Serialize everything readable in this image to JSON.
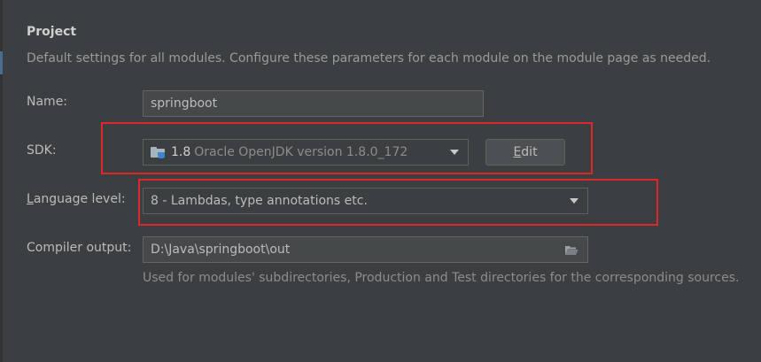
{
  "project": {
    "title": "Project",
    "description": "Default settings for all modules. Configure these parameters for each module on the module page as needed."
  },
  "name_row": {
    "label": "Name:",
    "value": "springboot"
  },
  "sdk_row": {
    "label": "SDK:",
    "sdk_version": "1.8",
    "sdk_detail": "Oracle OpenJDK version 1.8.0_172",
    "icon": "jdk-folder-icon",
    "edit_button": {
      "mnemonic": "E",
      "rest": "dit"
    }
  },
  "language_row": {
    "label_mnemonic": "L",
    "label_rest": "anguage level:",
    "selected": "8 - Lambdas, type annotations etc."
  },
  "compiler_row": {
    "label": "Compiler output:",
    "value": "D:\\Java\\springboot\\out",
    "icon": "folder-open-icon",
    "hint": "Used for modules' subdirectories, Production and Test directories for the corresponding sources."
  },
  "colors": {
    "background": "#3c3f41",
    "highlight": "#e0262a",
    "field": "#45494a"
  }
}
